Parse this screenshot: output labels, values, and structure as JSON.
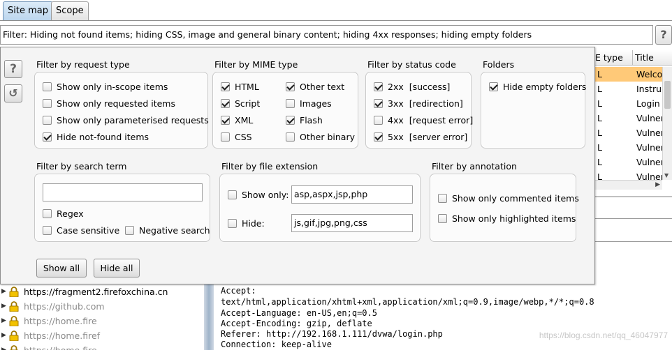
{
  "tabs": [
    {
      "label": "Site map",
      "active": true
    },
    {
      "label": "Scope",
      "active": false
    }
  ],
  "filter_bar": {
    "text": "Filter: Hiding not found items;  hiding CSS, image and general binary content;  hiding 4xx responses;  hiding empty folders",
    "help_icon": "question-icon"
  },
  "table": {
    "columns": [
      "E type",
      "Title"
    ],
    "rows": [
      {
        "type": "L",
        "title": "Welcor",
        "selected": true
      },
      {
        "type": "L",
        "title": "Instruct"
      },
      {
        "type": "L",
        "title": "Login :"
      },
      {
        "type": "L",
        "title": "Vulnera"
      },
      {
        "type": "L",
        "title": "Vulnera"
      },
      {
        "type": "L",
        "title": "Vulnera"
      },
      {
        "type": "L",
        "title": "Vulnera"
      },
      {
        "type": "L",
        "title": "Vulnera"
      }
    ]
  },
  "site_tree": [
    {
      "url": "https://fragment2.firefoxchina.cn",
      "dim": false
    },
    {
      "url": "https://github.com",
      "dim": true
    },
    {
      "url": "https://home.fire",
      "dim": true
    },
    {
      "url": "https://home.firef",
      "dim": true
    },
    {
      "url": "https://home.fire",
      "dim": true
    }
  ],
  "request_lines": [
    "Accept:",
    "text/html,application/xhtml+xml,application/xml;q=0.9,image/webp,*/*;q=0.8",
    "Accept-Language: en-US,en;q=0.5",
    "Accept-Encoding: gzip, deflate",
    "Referer: http://192.168.1.111/dvwa/login.php",
    "Connection: keep-alive"
  ],
  "watermark": "https://blog.csdn.net/qq_46047977",
  "popup": {
    "side_icons": [
      "help-icon",
      "restore-defaults-icon"
    ],
    "request_type": {
      "title": "Filter by request type",
      "options": [
        {
          "label": "Show only in-scope items",
          "checked": false
        },
        {
          "label": "Show only requested items",
          "checked": false
        },
        {
          "label": "Show only parameterised requests",
          "checked": false
        },
        {
          "label": "Hide not-found items",
          "checked": true
        }
      ]
    },
    "mime_type": {
      "title": "Filter by MIME type",
      "options": [
        {
          "label": "HTML",
          "checked": true
        },
        {
          "label": "Script",
          "checked": true
        },
        {
          "label": "XML",
          "checked": true
        },
        {
          "label": "CSS",
          "checked": false
        },
        {
          "label": "Other text",
          "checked": true
        },
        {
          "label": "Images",
          "checked": false
        },
        {
          "label": "Flash",
          "checked": true
        },
        {
          "label": "Other binary",
          "checked": false
        }
      ]
    },
    "status_code": {
      "title": "Filter by status code",
      "options": [
        {
          "label": "2xx  [success]",
          "checked": true
        },
        {
          "label": "3xx  [redirection]",
          "checked": true
        },
        {
          "label": "4xx  [request error]",
          "checked": false
        },
        {
          "label": "5xx  [server error]",
          "checked": true
        }
      ]
    },
    "folders": {
      "title": "Folders",
      "options": [
        {
          "label": "Hide empty folders",
          "checked": true
        }
      ]
    },
    "search_term": {
      "title": "Filter by search term",
      "value": "",
      "options": [
        {
          "label": "Regex",
          "checked": false
        },
        {
          "label": "Case sensitive",
          "checked": false
        },
        {
          "label": "Negative search",
          "checked": false
        }
      ]
    },
    "file_extension": {
      "title": "Filter by file extension",
      "show_only": {
        "label": "Show only:",
        "checked": false,
        "value": "asp,aspx,jsp,php"
      },
      "hide": {
        "label": "Hide:",
        "checked": false,
        "value": "js,gif,jpg,png,css"
      }
    },
    "annotation": {
      "title": "Filter by annotation",
      "options": [
        {
          "label": "Show only commented items",
          "checked": false
        },
        {
          "label": "Show only highlighted items",
          "checked": false
        }
      ]
    },
    "buttons": {
      "show_all": "Show all",
      "hide_all": "Hide all"
    }
  }
}
